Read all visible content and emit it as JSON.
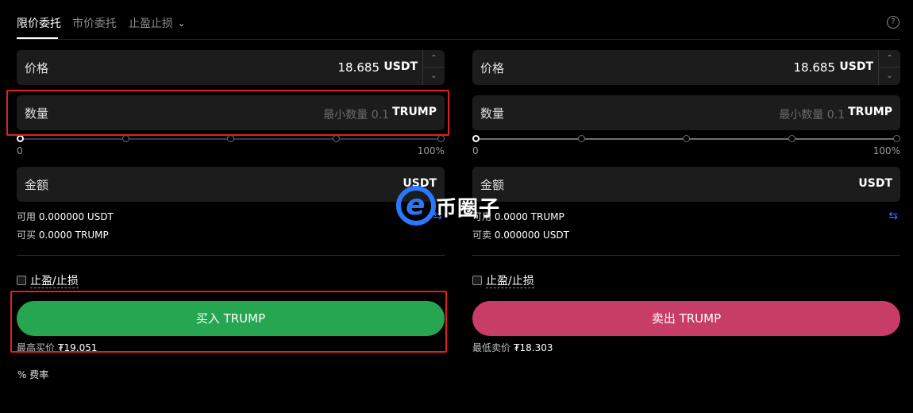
{
  "tabs": {
    "limit": "限价委托",
    "market": "市价委托",
    "tpsl": "止盈止损"
  },
  "help_icon_char": "?",
  "buy": {
    "price_label": "价格",
    "price_value": "18.685",
    "price_unit": "USDT",
    "qty_label": "数量",
    "qty_placeholder": "最小数量 0.1",
    "qty_unit": "TRUMP",
    "slider_min": "0",
    "slider_max": "100%",
    "slider_level": 0,
    "amount_label": "金额",
    "amount_unit": "USDT",
    "available_label": "可用",
    "available_value": "0.000000 USDT",
    "can_buy_label": "可买",
    "can_buy_value": "0.0000 TRUMP",
    "tpsl_label": "止盈/止损",
    "action_label": "买入 TRUMP",
    "best_label": "最高买价",
    "best_value": "₮19.051"
  },
  "sell": {
    "price_label": "价格",
    "price_value": "18.685",
    "price_unit": "USDT",
    "qty_label": "数量",
    "qty_placeholder": "最小数量 0.1",
    "qty_unit": "TRUMP",
    "slider_min": "0",
    "slider_max": "100%",
    "slider_level": 0,
    "amount_label": "金额",
    "amount_unit": "USDT",
    "available_label": "可用",
    "available_value": "0.0000 TRUMP",
    "can_sell_label": "可卖",
    "can_sell_value": "0.000000 USDT",
    "tpsl_label": "止盈/止损",
    "action_label": "卖出 TRUMP",
    "best_label": "最低卖价",
    "best_value": "₮18.303"
  },
  "fee": {
    "icon": "%",
    "label": "费率"
  },
  "watermark": {
    "text": "币圈子"
  },
  "colors": {
    "buy": "#26a650",
    "sell": "#c83d66",
    "highlight": "#e02020",
    "swap": "#3d6bff"
  },
  "icons": [
    "help-icon",
    "chevron-down-icon",
    "stepper-up-icon",
    "stepper-down-icon",
    "swap-icon",
    "percent-icon",
    "checkbox-icon"
  ]
}
